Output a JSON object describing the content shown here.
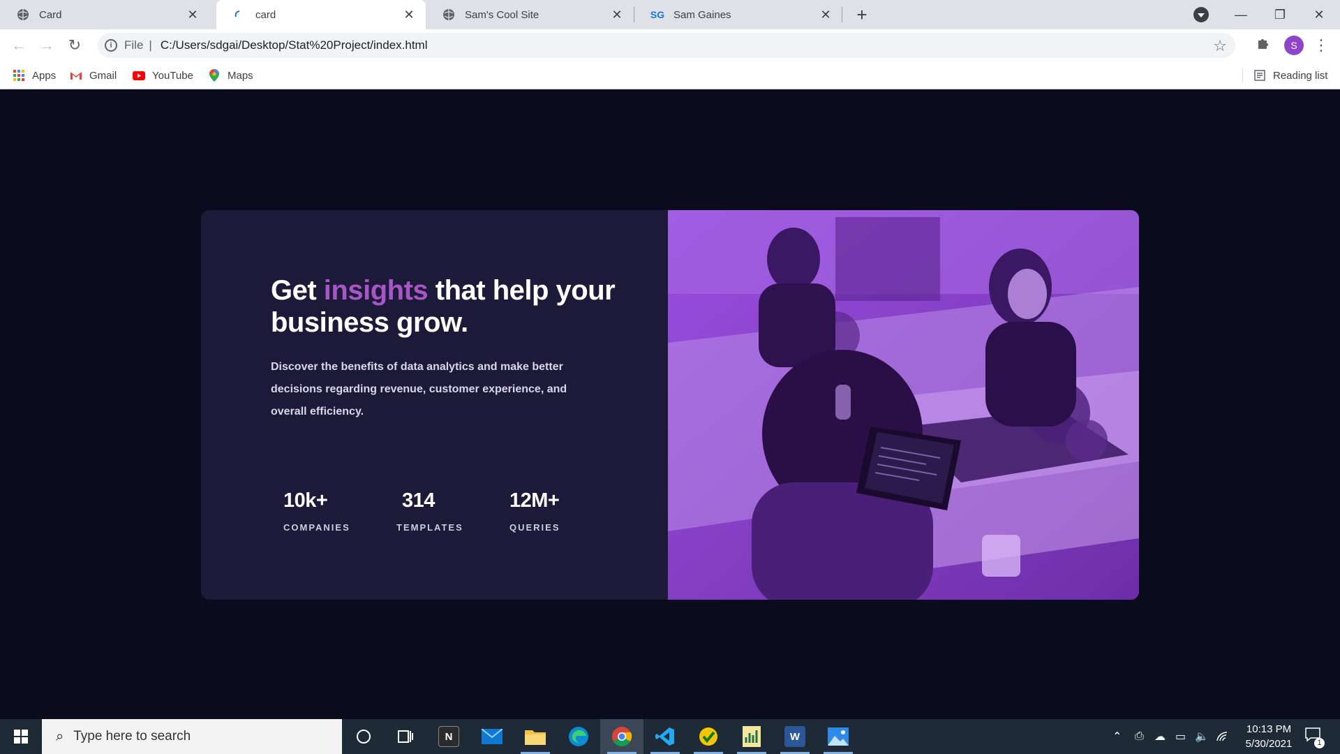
{
  "browser": {
    "tabs": [
      {
        "title": "Card",
        "icon": "globe-icon",
        "active": false
      },
      {
        "title": "card",
        "icon": "loading-icon",
        "active": true
      },
      {
        "title": "Sam's Cool Site",
        "icon": "globe-icon",
        "active": false
      },
      {
        "title": "Sam Gaines",
        "icon": "sg-logo-icon",
        "active": false,
        "favicon_text": "SG"
      }
    ],
    "address": {
      "scheme_label": "File",
      "url": "C:/Users/sdgai/Desktop/Stat%20Project/index.html"
    },
    "profile_initial": "S",
    "bookmarks": [
      {
        "label": "Apps",
        "icon": "apps-grid-icon"
      },
      {
        "label": "Gmail",
        "icon": "gmail-icon"
      },
      {
        "label": "YouTube",
        "icon": "youtube-icon"
      },
      {
        "label": "Maps",
        "icon": "maps-pin-icon"
      }
    ],
    "reading_list": "Reading list"
  },
  "card": {
    "headline_pre": "Get ",
    "headline_accent": "insights",
    "headline_post": " that help your business grow.",
    "description": "Discover the benefits of data analytics and make better decisions regarding revenue, customer experience, and overall efficiency.",
    "stats": [
      {
        "value": "10k+",
        "label": "COMPANIES"
      },
      {
        "value": "314",
        "label": "TEMPLATES"
      },
      {
        "value": "12M+",
        "label": "QUERIES"
      }
    ],
    "colors": {
      "background": "#0a0c1d",
      "card": "#1c1a38",
      "accent": "#a855c7",
      "photo_tint": "#8c3ecf"
    }
  },
  "taskbar": {
    "search_placeholder": "Type here to search",
    "apps": [
      "cortana-icon",
      "task-view-icon",
      "notion-icon",
      "mail-icon",
      "file-explorer-icon",
      "edge-icon",
      "chrome-icon",
      "vscode-icon",
      "norton-icon",
      "excel-like-icon",
      "word-icon",
      "photos-icon"
    ],
    "time": "10:13 PM",
    "date": "5/30/2021",
    "notification_count": "1"
  }
}
